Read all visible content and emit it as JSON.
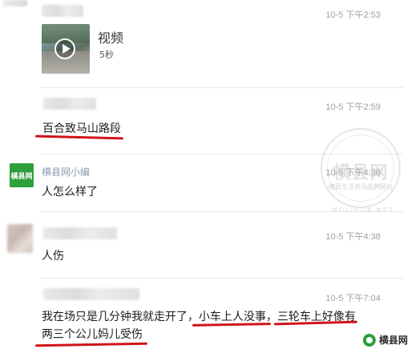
{
  "messages": [
    {
      "sender": "",
      "time": "10-5 下午2:53",
      "video": {
        "title": "视频",
        "duration": "5秒",
        "icon": "play-icon"
      }
    },
    {
      "sender": "",
      "time": "10-5 下午2:59",
      "text": "百合致马山路段"
    },
    {
      "sender": "横县网小编",
      "avatar_text": "横县网",
      "time": "10-5 下午4:38",
      "text": "人怎么样了"
    },
    {
      "sender": "",
      "time": "10-5 下午4:38",
      "text": "人伤"
    },
    {
      "sender": "",
      "time": "10-5 下午7:04",
      "text_line1": "我在场只是几分钟我就走开了，小车上人没事，三轮车上好像有",
      "text_line2": "两三个公儿妈儿受伤"
    }
  ],
  "watermark": {
    "title": "横县网",
    "subtitle": "横县生活资讯品牌网站",
    "url": "MOLIHUA.NET"
  },
  "brand": {
    "label": "横县网"
  },
  "colors": {
    "underline": "#d0141b",
    "avatar_green": "#2f9e3c",
    "timestamp": "#a0a0a0",
    "sender": "#8a9bb0"
  }
}
